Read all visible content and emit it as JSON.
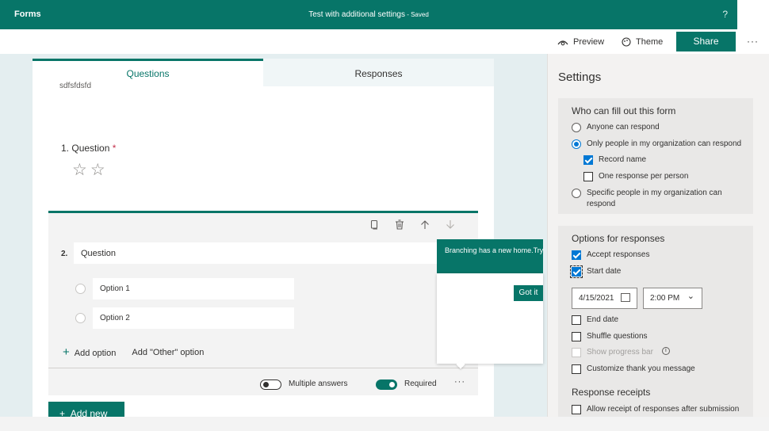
{
  "header": {
    "app_name": "Forms",
    "form_title": "Test with additional settings",
    "separator": " - ",
    "save_status": "Saved",
    "help": "?"
  },
  "toolbar": {
    "preview_label": "Preview",
    "theme_label": "Theme",
    "share_label": "Share",
    "more": "···"
  },
  "tabs": {
    "questions": "Questions",
    "responses": "Responses"
  },
  "form": {
    "cut_text": "sdfsfdsfd",
    "q1": {
      "number": "1.",
      "label": "Question",
      "required_mark": "*",
      "stars": "☆☆"
    },
    "q2": {
      "number": "2.",
      "question_value": "Question",
      "options": [
        "Option 1",
        "Option 2"
      ],
      "add_option": "Add option",
      "add_other": "Add \"Other\" option",
      "multiple_answers_label": "Multiple answers",
      "multiple_answers_on": false,
      "required_label": "Required",
      "required_on": true,
      "more": "···"
    },
    "add_new": "Add new"
  },
  "popup": {
    "text": "Branching has a new home.Try it out!",
    "button": "Got it"
  },
  "settings": {
    "title": "Settings",
    "who_title": "Who can fill out this form",
    "who_options": [
      "Anyone can respond",
      "Only people in my organization can respond",
      "Specific people in my organization can respond"
    ],
    "record_name": "Record name",
    "one_response": "One response per person",
    "options_title": "Options for responses",
    "accept_responses": "Accept responses",
    "start_date": "Start date",
    "date_value": "4/15/2021",
    "time_value": "2:00 PM",
    "end_date": "End date",
    "shuffle": "Shuffle questions",
    "progress_bar": "Show progress bar",
    "thank_you": "Customize thank you message",
    "receipts_title": "Response receipts",
    "allow_receipt": "Allow receipt of responses after submission"
  },
  "colors": {
    "accent": "#077568",
    "checkbox": "#0078d4",
    "required": "#c4314b"
  }
}
